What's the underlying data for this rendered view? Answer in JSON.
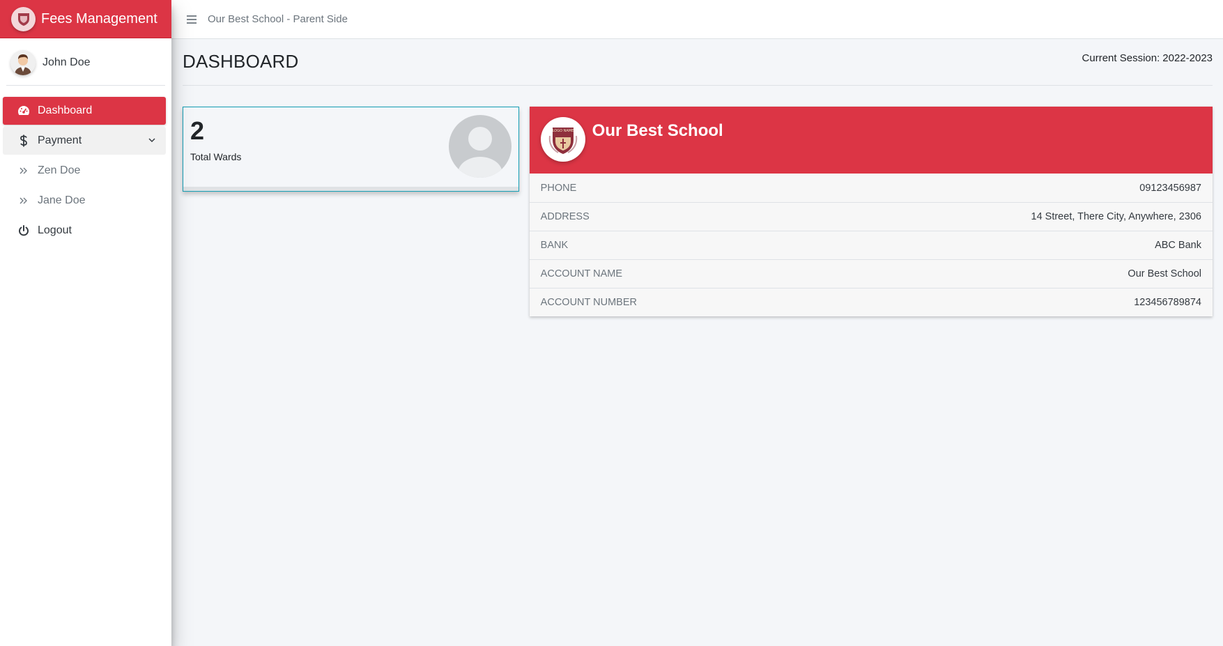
{
  "brand": {
    "title": "Fees Management",
    "color": "#dc3545"
  },
  "user": {
    "name": "John Doe"
  },
  "sidebar": {
    "items": [
      {
        "label": "Dashboard",
        "icon": "tachometer-icon",
        "active": true
      },
      {
        "label": "Payment",
        "icon": "dollar-icon",
        "expanded": true
      },
      {
        "label": "Zen Doe",
        "icon": "double-chevron-right-icon"
      },
      {
        "label": "Jane Doe",
        "icon": "double-chevron-right-icon"
      },
      {
        "label": "Logout",
        "icon": "power-icon"
      }
    ]
  },
  "topbar": {
    "title": "Our Best School - Parent Side"
  },
  "page": {
    "title": "DASHBOARD",
    "session_label": "Current Session:",
    "session_value": "2022-2023"
  },
  "wards": {
    "count": "2",
    "label": "Total Wards",
    "icon": "user-circle-icon"
  },
  "school": {
    "name": "Our Best School",
    "logo_text": "LOGO NAME",
    "rows": [
      {
        "label": "PHONE",
        "value": "09123456987"
      },
      {
        "label": "ADDRESS",
        "value": "14 Street, There City, Anywhere, 2306"
      },
      {
        "label": "BANK",
        "value": "ABC Bank"
      },
      {
        "label": "ACCOUNT NAME",
        "value": "Our Best School"
      },
      {
        "label": "ACCOUNT NUMBER",
        "value": "123456789874"
      }
    ]
  }
}
